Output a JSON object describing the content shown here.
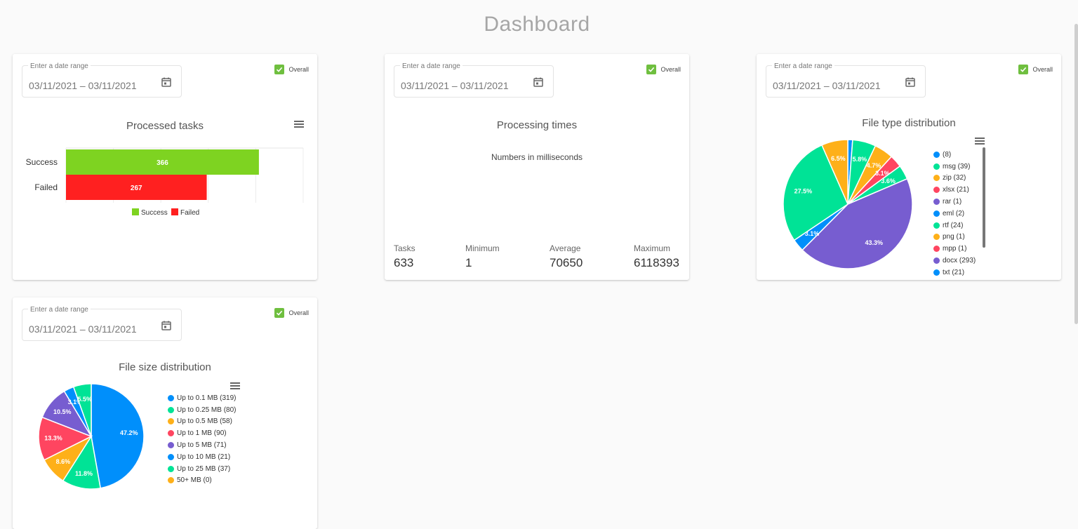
{
  "page": {
    "title": "Dashboard"
  },
  "colors": {
    "success": "#7ed321",
    "failed": "#ff2020",
    "checkbox": "#6fbf3f",
    "palette": [
      "#008ffb",
      "#00e396",
      "#feb019",
      "#ff4560",
      "#775dd0"
    ]
  },
  "date_picker": {
    "label": "Enter a date range",
    "value": "03/11/2021 – 03/11/2021",
    "icon": "calendar-icon"
  },
  "overall_label": "Overall",
  "processed_tasks": {
    "title": "Processed tasks",
    "chart_data": {
      "type": "bar",
      "orientation": "horizontal",
      "title": "Processed tasks",
      "categories": [
        "Success",
        "Failed"
      ],
      "values": [
        366,
        267
      ],
      "colors": [
        "#7ed321",
        "#ff2020"
      ],
      "xlim": [
        0,
        450
      ],
      "grid": true,
      "legend": [
        "Success",
        "Failed"
      ],
      "legend_position": "bottom"
    }
  },
  "processing_times": {
    "title": "Processing times",
    "subtitle": "Numbers in milliseconds",
    "stats": [
      {
        "label": "Tasks",
        "value": "633"
      },
      {
        "label": "Minimum",
        "value": "1"
      },
      {
        "label": "Average",
        "value": "70650"
      },
      {
        "label": "Maximum",
        "value": "6118393"
      }
    ]
  },
  "file_type": {
    "title": "File type distribution",
    "chart_data": {
      "type": "pie",
      "title": "File type distribution",
      "labels": [
        "",
        "msg",
        "zip",
        "xlsx",
        "rar",
        "eml",
        "rtf",
        "png",
        "mpp",
        "docx",
        "txt"
      ],
      "values": [
        8,
        39,
        32,
        21,
        1,
        2,
        24,
        1,
        1,
        293,
        21
      ],
      "colors": [
        "#008ffb",
        "#00e396",
        "#feb019",
        "#ff4560",
        "#775dd0",
        "#008ffb",
        "#00e396",
        "#feb019",
        "#ff4560",
        "#775dd0",
        "#008ffb"
      ],
      "data_labels": [
        "",
        "5.8%",
        "4.7%",
        "3.1%",
        "",
        "",
        "3.6%",
        "",
        "",
        "43.3%",
        "3.1%",
        "27.5%",
        "6.5%"
      ],
      "legend_position": "right"
    },
    "legend": [
      "(8)",
      "msg (39)",
      "zip (32)",
      "xlsx (21)",
      "rar (1)",
      "eml (2)",
      "rtf (24)",
      "png (1)",
      "mpp (1)",
      "docx (293)",
      "txt (21)"
    ],
    "hidden_slices": [
      {
        "label": "",
        "value": 186,
        "color": "#00e396",
        "data_label": "27.5%"
      },
      {
        "label": "",
        "value": 44,
        "color": "#feb019",
        "data_label": "6.5%"
      }
    ]
  },
  "file_size": {
    "title": "File size distribution",
    "chart_data": {
      "type": "pie",
      "title": "File size distribution",
      "labels": [
        "Up to 0.1 MB",
        "Up to 0.25 MB",
        "Up to 0.5 MB",
        "Up to 1 MB",
        "Up to 5 MB",
        "Up to 10 MB",
        "Up to 25 MB",
        "50+ MB"
      ],
      "values": [
        319,
        80,
        58,
        90,
        71,
        21,
        37,
        0
      ],
      "colors": [
        "#008ffb",
        "#00e396",
        "#feb019",
        "#ff4560",
        "#775dd0",
        "#008ffb",
        "#00e396",
        "#feb019"
      ],
      "data_labels": [
        "47.2%",
        "11.8%",
        "8.6%",
        "13.3%",
        "10.5%",
        "3.1%",
        "5.5%",
        ""
      ],
      "legend_position": "right"
    },
    "legend": [
      "Up to 0.1 MB (319)",
      "Up to 0.25 MB (80)",
      "Up to 0.5 MB (58)",
      "Up to 1 MB (90)",
      "Up to 5 MB (71)",
      "Up to 10 MB (21)",
      "Up to 25 MB (37)",
      "50+ MB (0)"
    ]
  }
}
